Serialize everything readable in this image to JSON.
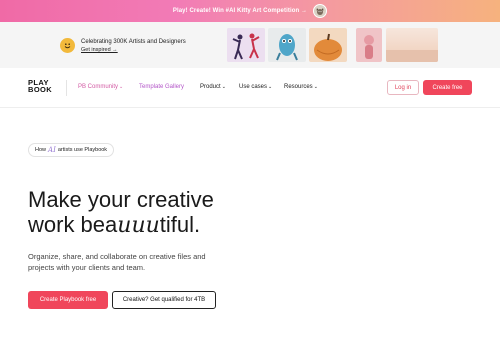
{
  "promo_bar": {
    "text": "Play! Create! Win #AI Kitty Art Competition →",
    "avatar_icon": "kitty-avatar"
  },
  "celebration": {
    "badge_icon": "smiley-face-icon",
    "title": "Celebrating 300K Artists and Designers",
    "link_label": "Get inspired →",
    "thumbnails": [
      "dancers-artwork",
      "blue-creature-artwork",
      "pumpkin-artwork",
      "pink-figure-artwork",
      "sunset-landscape-artwork"
    ]
  },
  "nav": {
    "logo_line1": "PLAY",
    "logo_line2": "BOOK",
    "items": [
      {
        "label": "PB Community"
      },
      {
        "label": "Template Gallery"
      },
      {
        "label": "Product"
      },
      {
        "label": "Use cases"
      },
      {
        "label": "Resources"
      }
    ],
    "chevron": "⌄",
    "login_label": "Log in",
    "create_label": "Create free"
  },
  "hero": {
    "pill_prefix": "How",
    "pill_ai": "AI",
    "pill_suffix": "artists use Playbook",
    "headline_line1": "Make your creative",
    "headline_line2_a": "work bea",
    "headline_line2_em": "uuu",
    "headline_line2_b": "tiful.",
    "subtext": "Organize, share, and collaborate on creative files and projects with your clients and team.",
    "primary_cta": "Create Playbook free",
    "secondary_cta": "Creative? Get qualified for 4TB"
  },
  "colors": {
    "accent": "#f0465b",
    "community": "#d35ba4",
    "template": "#b355c8"
  }
}
